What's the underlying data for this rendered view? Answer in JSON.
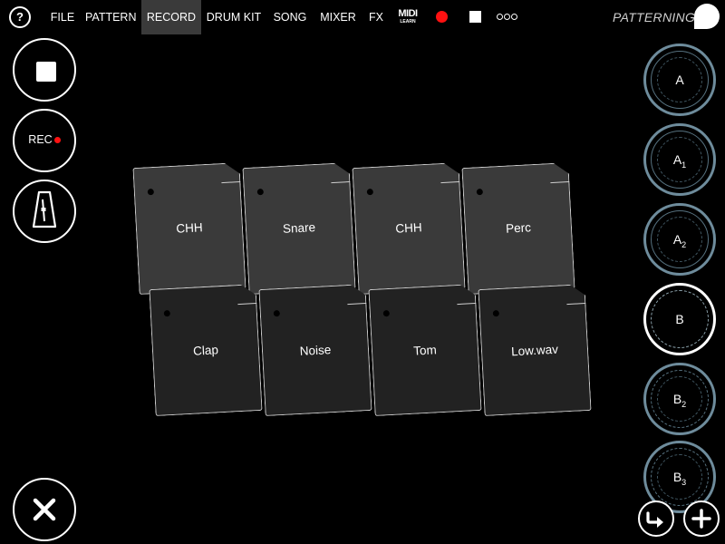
{
  "menu": {
    "help_label": "?",
    "items": [
      {
        "label": "FILE"
      },
      {
        "label": "PATTERN"
      },
      {
        "label": "RECORD"
      },
      {
        "label": "DRUM KIT"
      },
      {
        "label": "SONG"
      },
      {
        "label": "MIXER"
      },
      {
        "label": "FX"
      }
    ],
    "active": "RECORD",
    "midi_learn": {
      "line1": "MIDI",
      "line2": "LEARN"
    },
    "app_title": "PATTERNING 2"
  },
  "left_controls": {
    "rec_label": "REC"
  },
  "pads": [
    {
      "label": "CHH"
    },
    {
      "label": "Snare"
    },
    {
      "label": "CHH"
    },
    {
      "label": "Perc"
    },
    {
      "label": "Clap"
    },
    {
      "label": "Noise"
    },
    {
      "label": "Tom"
    },
    {
      "label": "Low.wav"
    }
  ],
  "patterns": [
    {
      "letter": "A",
      "sub": ""
    },
    {
      "letter": "A",
      "sub": "1"
    },
    {
      "letter": "A",
      "sub": "2"
    },
    {
      "letter": "B",
      "sub": ""
    },
    {
      "letter": "B",
      "sub": "2"
    },
    {
      "letter": "B",
      "sub": "3"
    }
  ],
  "selected_pattern": "B",
  "icons": {
    "stop": "stop-icon",
    "record": "record-icon",
    "metronome": "metronome-icon",
    "close": "close-icon",
    "redirect": "arrow-redirect-icon",
    "add": "plus-icon"
  },
  "colors": {
    "record_red": "#ff1111",
    "pattern_ring": "#6e8c9c",
    "active_menu_bg": "#3a3a3a"
  }
}
